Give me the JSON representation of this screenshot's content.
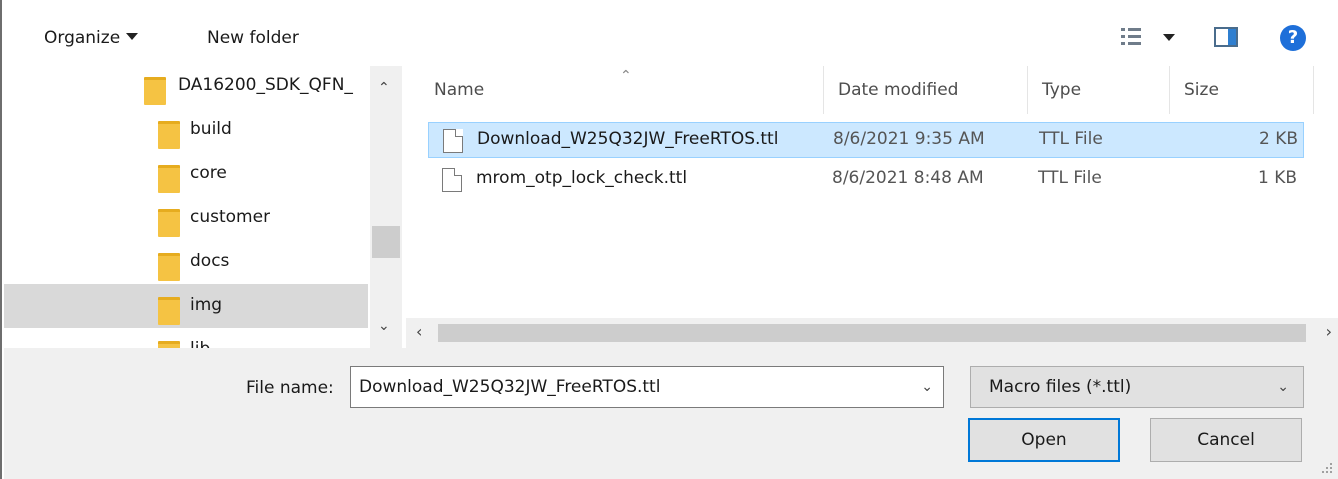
{
  "toolbar": {
    "organize_label": "Organize",
    "new_folder_label": "New folder",
    "view_icon": "details-view-icon",
    "preview_icon": "preview-pane-icon",
    "help_icon": "help-icon",
    "help_glyph": "?"
  },
  "nav": {
    "items": [
      {
        "label": "DA16200_SDK_QFN_"
      },
      {
        "label": "build"
      },
      {
        "label": "core"
      },
      {
        "label": "customer"
      },
      {
        "label": "docs"
      },
      {
        "label": "img"
      },
      {
        "label": "lib"
      }
    ],
    "selected": "img"
  },
  "list": {
    "columns": {
      "name": "Name",
      "date": "Date modified",
      "type": "Type",
      "size": "Size"
    },
    "rows": [
      {
        "name": "Download_W25Q32JW_FreeRTOS.ttl",
        "date": "8/6/2021 9:35 AM",
        "type": "TTL File",
        "size": "2 KB"
      },
      {
        "name": "mrom_otp_lock_check.ttl",
        "date": "8/6/2021 8:48 AM",
        "type": "TTL File",
        "size": "1 KB"
      }
    ]
  },
  "footer": {
    "file_name_label": "File name:",
    "file_name_value": "Download_W25Q32JW_FreeRTOS.ttl",
    "file_type_value": "Macro files (*.ttl)",
    "open_label": "Open",
    "cancel_label": "Cancel"
  },
  "colors": {
    "selection_bg": "#cce8ff",
    "selection_border": "#99d1ff",
    "accent": "#0078d7",
    "folder": "#f5c343"
  }
}
